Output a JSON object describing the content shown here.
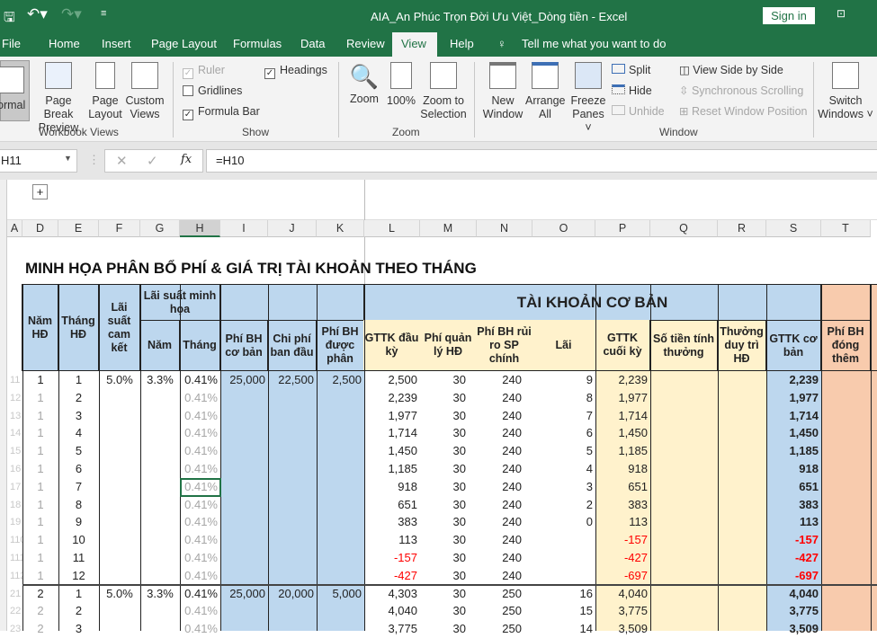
{
  "window": {
    "title": "AIA_An Phúc Trọn Đời Ưu Việt_Dòng tiền  -  Excel",
    "sign_in": "Sign in"
  },
  "tabs": [
    "File",
    "Home",
    "Insert",
    "Page Layout",
    "Formulas",
    "Data",
    "View",
    "Review",
    "Help"
  ],
  "tell_me": "Tell me what you want to do",
  "ribbon": {
    "workbook_views": {
      "label": "Workbook Views",
      "normal": "ormal",
      "page_break": "Page Break Preview",
      "page_layout": "Page Layout",
      "custom_views": "Custom Views"
    },
    "show": {
      "label": "Show",
      "ruler": "Ruler",
      "gridlines": "Gridlines",
      "formula_bar": "Formula Bar",
      "headings": "Headings",
      "ruler_checked": true,
      "gridlines_checked": false,
      "formula_bar_checked": true,
      "headings_checked": true
    },
    "zoom": {
      "label": "Zoom",
      "zoom": "Zoom",
      "hundred": "100%",
      "zoom_sel": "Zoom to Selection"
    },
    "window": {
      "label": "Window",
      "new_window": "New Window",
      "arrange_all": "Arrange All",
      "freeze": "Freeze Panes",
      "split": "Split",
      "hide": "Hide",
      "unhide": "Unhide",
      "side_by_side": "View Side by Side",
      "sync_scroll": "Synchronous Scrolling",
      "reset_pos": "Reset Window Position",
      "switch": "Switch Windows"
    }
  },
  "formula_bar": {
    "name_box": "H11",
    "formula": "=H10"
  },
  "columns": [
    "A",
    "D",
    "E",
    "F",
    "G",
    "H",
    "I",
    "J",
    "K",
    "L",
    "M",
    "N",
    "O",
    "P",
    "Q",
    "R",
    "S",
    "T"
  ],
  "sheet": {
    "title": "MINH HỌA PHÂN BỔ PHÍ & GIÁ TRỊ TÀI KHOẢN THEO THÁNG",
    "headers": {
      "nam_hd": "Năm HĐ",
      "thang_hd": "Tháng HĐ",
      "lai_cam_ket": "Lãi suất cam kết",
      "lai_minh_hoa": "Lãi suất minh họa",
      "nam": "Năm",
      "thang": "Tháng",
      "phi_bh_co_ban": "Phí BH cơ bản",
      "chi_phi_ban_dau": "Chi phí ban đầu",
      "phi_bh_duoc_phan": "Phí BH được phân",
      "tai_khoan": "TÀI KHOẢN CƠ BẢN",
      "gttk_dau": "GTTK đầu kỳ",
      "phi_quan_ly": "Phí quản lý HĐ",
      "phi_rui_ro": "Phí BH rủi ro SP chính",
      "lai": "Lãi",
      "gttk_cuoi": "GTTK cuối kỳ",
      "so_tien_thuong": "Số tiền tính thưởng",
      "thuong_duy_tri": "Thưởng duy trì HĐ",
      "gttk_co_ban": "GTTK cơ bản",
      "phi_dong_them": "Phí BH đóng thêm"
    },
    "rows": [
      [
        "11",
        "1",
        "1",
        "5.0%",
        "3.3%",
        "0.41%",
        "25,000",
        "22,500",
        "2,500",
        "2,500",
        "30",
        "240",
        "9",
        "2,239",
        "",
        "",
        "2,239"
      ],
      [
        "12",
        "1",
        "2",
        "",
        "",
        "0.41%",
        "",
        "",
        "",
        "2,239",
        "30",
        "240",
        "8",
        "1,977",
        "",
        "",
        "1,977"
      ],
      [
        "13",
        "1",
        "3",
        "",
        "",
        "0.41%",
        "",
        "",
        "",
        "1,977",
        "30",
        "240",
        "7",
        "1,714",
        "",
        "",
        "1,714"
      ],
      [
        "14",
        "1",
        "4",
        "",
        "",
        "0.41%",
        "",
        "",
        "",
        "1,714",
        "30",
        "240",
        "6",
        "1,450",
        "",
        "",
        "1,450"
      ],
      [
        "15",
        "1",
        "5",
        "",
        "",
        "0.41%",
        "",
        "",
        "",
        "1,450",
        "30",
        "240",
        "5",
        "1,185",
        "",
        "",
        "1,185"
      ],
      [
        "16",
        "1",
        "6",
        "",
        "",
        "0.41%",
        "",
        "",
        "",
        "1,185",
        "30",
        "240",
        "4",
        "918",
        "",
        "",
        "918"
      ],
      [
        "17",
        "1",
        "7",
        "",
        "",
        "0.41%",
        "",
        "",
        "",
        "918",
        "30",
        "240",
        "3",
        "651",
        "",
        "",
        "651"
      ],
      [
        "18",
        "1",
        "8",
        "",
        "",
        "0.41%",
        "",
        "",
        "",
        "651",
        "30",
        "240",
        "2",
        "383",
        "",
        "",
        "383"
      ],
      [
        "19",
        "1",
        "9",
        "",
        "",
        "0.41%",
        "",
        "",
        "",
        "383",
        "30",
        "240",
        "0",
        "113",
        "",
        "",
        "113"
      ],
      [
        "110",
        "1",
        "10",
        "",
        "",
        "0.41%",
        "",
        "",
        "",
        "113",
        "30",
        "240",
        "",
        "-157",
        "",
        "",
        "-157"
      ],
      [
        "111",
        "1",
        "11",
        "",
        "",
        "0.41%",
        "",
        "",
        "",
        "-157",
        "30",
        "240",
        "",
        "-427",
        "",
        "",
        "-427"
      ],
      [
        "112",
        "1",
        "12",
        "",
        "",
        "0.41%",
        "",
        "",
        "",
        "-427",
        "30",
        "240",
        "",
        "-697",
        "",
        "",
        "-697"
      ],
      [
        "21",
        "2",
        "1",
        "5.0%",
        "3.3%",
        "0.41%",
        "25,000",
        "20,000",
        "5,000",
        "4,303",
        "30",
        "250",
        "16",
        "4,040",
        "",
        "",
        "4,040"
      ],
      [
        "22",
        "2",
        "2",
        "",
        "",
        "0.41%",
        "",
        "",
        "",
        "4,040",
        "30",
        "250",
        "15",
        "3,775",
        "",
        "",
        "3,775"
      ],
      [
        "23",
        "2",
        "3",
        "",
        "",
        "0.41%",
        "",
        "",
        "",
        "3,775",
        "30",
        "250",
        "14",
        "3,509",
        "",
        "",
        "3,509"
      ]
    ]
  },
  "colors": {
    "excel_green": "#217346",
    "header_blue": "#BDD7EE",
    "beige": "#FFF2CC",
    "orange": "#F8CBAD",
    "negative": "#FF0000"
  }
}
